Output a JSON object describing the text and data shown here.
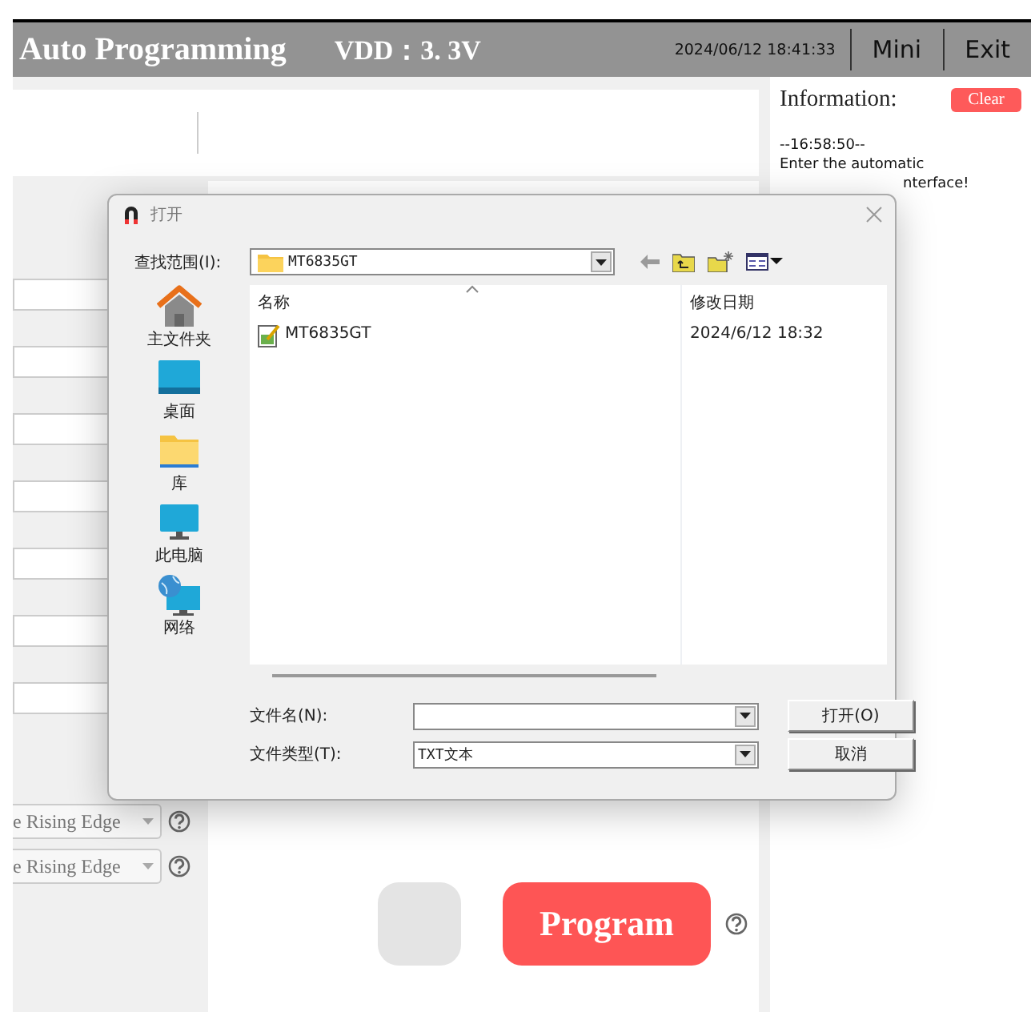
{
  "header": {
    "title": "Auto Programming",
    "vdd": "VDD：3. 3V",
    "datetime": "2024/06/12  18:41:33",
    "buttons": [
      "Mini",
      "Exit"
    ]
  },
  "left_panel": {
    "fields": [
      {
        "kind": "input"
      },
      {
        "kind": "input"
      },
      {
        "kind": "input"
      },
      {
        "kind": "input"
      },
      {
        "kind": "input"
      },
      {
        "kind": "input"
      },
      {
        "kind": "input"
      }
    ],
    "dropdowns": [
      {
        "value": "e Rising Edge"
      },
      {
        "value": "e Rising Edge"
      }
    ]
  },
  "main": {
    "program_button": "Program"
  },
  "info": {
    "title": "Information:",
    "clear_button": "Clear",
    "log": [
      {
        "text": "--16:58:50--",
        "kind": "line"
      },
      {
        "text": "Enter the automatic",
        "kind": "line"
      },
      {
        "text": "nterface!",
        "kind": "cut"
      }
    ]
  },
  "dialog": {
    "title": "打开",
    "look_in_label": "查找范围(I):",
    "look_in_value": "MT6835GT",
    "places": [
      {
        "label": "主文件夹",
        "kind": "home"
      },
      {
        "label": "桌面",
        "kind": "desktop"
      },
      {
        "label": "库",
        "kind": "library"
      },
      {
        "label": "此电脑",
        "kind": "computer"
      },
      {
        "label": "网络",
        "kind": "network"
      }
    ],
    "columns": [
      "名称",
      "修改日期"
    ],
    "files": [
      {
        "name": "MT6835GT",
        "modified": "2024/6/12 18:32"
      }
    ],
    "file_name_label": "文件名(N):",
    "file_type_label": "文件类型(T):",
    "file_type_value": "TXT文本",
    "buttons": [
      "打开(O)",
      "取消"
    ]
  }
}
